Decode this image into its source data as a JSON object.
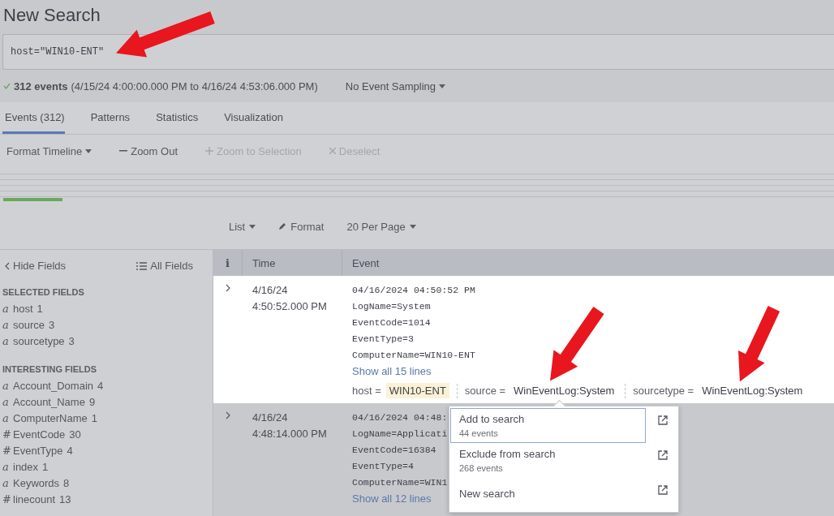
{
  "page": {
    "title": "New Search"
  },
  "search": {
    "value": "host=\"WIN10-ENT\""
  },
  "status": {
    "count": "312 events",
    "range": "(4/15/24 4:00:00.000 PM to 4/16/24 4:53:06.000 PM)",
    "sampling": "No Event Sampling"
  },
  "tabs": [
    {
      "label": "Events (312)",
      "selected": true
    },
    {
      "label": "Patterns",
      "selected": false
    },
    {
      "label": "Statistics",
      "selected": false
    },
    {
      "label": "Visualization",
      "selected": false
    }
  ],
  "timeline_toolbar": [
    {
      "label": "Format Timeline",
      "kind": "menu",
      "disabled": false
    },
    {
      "label": "Zoom Out",
      "kind": "minus",
      "disabled": false
    },
    {
      "label": "Zoom to Selection",
      "kind": "plus",
      "disabled": true
    },
    {
      "label": "Deselect",
      "kind": "cross",
      "disabled": true
    }
  ],
  "timeline": {
    "level": 0.072
  },
  "results_toolbar": [
    {
      "label": "List",
      "kind": "menu"
    },
    {
      "label": "Format",
      "kind": "pencil"
    },
    {
      "label": "20 Per Page",
      "kind": "menu"
    }
  ],
  "sidebar": {
    "hide_fields": "Hide Fields",
    "all_fields": "All Fields",
    "groups": [
      {
        "title": "SELECTED FIELDS",
        "fields": [
          {
            "type_glyph": "a",
            "name": "host",
            "count": "1"
          },
          {
            "type_glyph": "a",
            "name": "source",
            "count": "3"
          },
          {
            "type_glyph": "a",
            "name": "sourcetype",
            "count": "3"
          }
        ]
      },
      {
        "title": "INTERESTING FIELDS",
        "fields": [
          {
            "type_glyph": "a",
            "name": "Account_Domain",
            "count": "4"
          },
          {
            "type_glyph": "a",
            "name": "Account_Name",
            "count": "9"
          },
          {
            "type_glyph": "a",
            "name": "ComputerName",
            "count": "1"
          },
          {
            "type_glyph": "#",
            "name": "EventCode",
            "count": "30"
          },
          {
            "type_glyph": "#",
            "name": "EventType",
            "count": "4"
          },
          {
            "type_glyph": "a",
            "name": "index",
            "count": "1"
          },
          {
            "type_glyph": "a",
            "name": "Keywords",
            "count": "8"
          },
          {
            "type_glyph": "#",
            "name": "linecount",
            "count": "13"
          }
        ]
      }
    ]
  },
  "table": {
    "columns": [
      "i",
      "Time",
      "Event"
    ],
    "rows": [
      {
        "focused": true,
        "date": "4/16/24",
        "time": "4:50:52.000 PM",
        "lines": [
          "04/16/2024 04:50:52 PM",
          "LogName=System",
          "EventCode=1014",
          "EventType=3",
          "ComputerName=WIN10-ENT"
        ],
        "show_all": "Show all 15 lines",
        "fields": [
          {
            "key": "host =",
            "value": "WIN10-ENT",
            "highlighted": true
          },
          {
            "key": "source =",
            "value": "WinEventLog:System",
            "highlighted": false
          },
          {
            "key": "sourcetype =",
            "value": "WinEventLog:System",
            "highlighted": false
          }
        ]
      },
      {
        "focused": false,
        "date": "4/16/24",
        "time": "4:48:14.000 PM",
        "lines": [
          "04/16/2024 04:48:",
          "LogName=Applicati",
          "EventCode=16384",
          "EventType=4",
          "ComputerName=WIN1"
        ],
        "show_all": "Show all 12 lines",
        "fields": []
      }
    ]
  },
  "popup": {
    "items": [
      {
        "label": "Add to search",
        "count": "44 events",
        "selected": true
      },
      {
        "label": "Exclude from search",
        "count": "268 events",
        "selected": false
      },
      {
        "label": "New search",
        "selected": false
      }
    ]
  }
}
